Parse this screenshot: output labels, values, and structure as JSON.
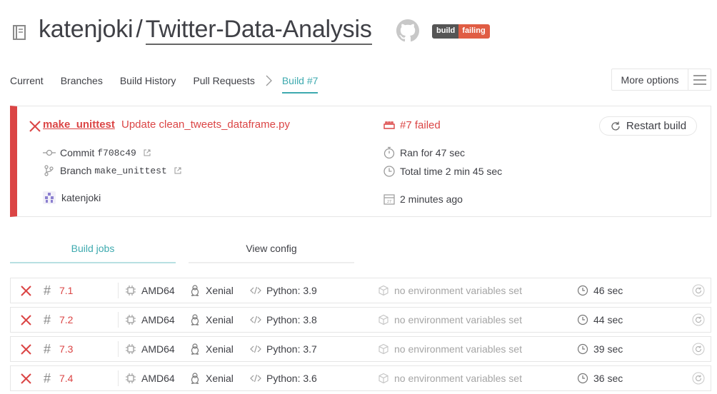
{
  "header": {
    "owner": "katenjoki",
    "separator": "/",
    "repo": "Twitter-Data-Analysis",
    "badge_left": "build",
    "badge_right": "failing"
  },
  "tabs": [
    "Current",
    "Branches",
    "Build History",
    "Pull Requests"
  ],
  "active_tab": "Build #7",
  "more_options": "More options",
  "build": {
    "job_name": "make_unittest",
    "commit_message": "Update clean_tweets_dataframe.py",
    "commit_label": "Commit",
    "commit_hash": "f708c49",
    "branch_label": "Branch",
    "branch_name": "make_unittest",
    "author": "katenjoki",
    "status": "#7 failed",
    "ran_for": "Ran for 47 sec",
    "total_time": "Total time 2 min 45 sec",
    "finished": "2 minutes ago",
    "restart_label": "Restart build",
    "status_color": "#db4545"
  },
  "subtabs": {
    "jobs": "Build jobs",
    "config": "View config"
  },
  "jobs": [
    {
      "number": "7.1",
      "arch": "AMD64",
      "os": "Xenial",
      "lang": "Python: 3.9",
      "env": "no environment variables set",
      "duration": "46 sec"
    },
    {
      "number": "7.2",
      "arch": "AMD64",
      "os": "Xenial",
      "lang": "Python: 3.8",
      "env": "no environment variables set",
      "duration": "44 sec"
    },
    {
      "number": "7.3",
      "arch": "AMD64",
      "os": "Xenial",
      "lang": "Python: 3.7",
      "env": "no environment variables set",
      "duration": "39 sec"
    },
    {
      "number": "7.4",
      "arch": "AMD64",
      "os": "Xenial",
      "lang": "Python: 3.6",
      "env": "no environment variables set",
      "duration": "36 sec"
    }
  ]
}
